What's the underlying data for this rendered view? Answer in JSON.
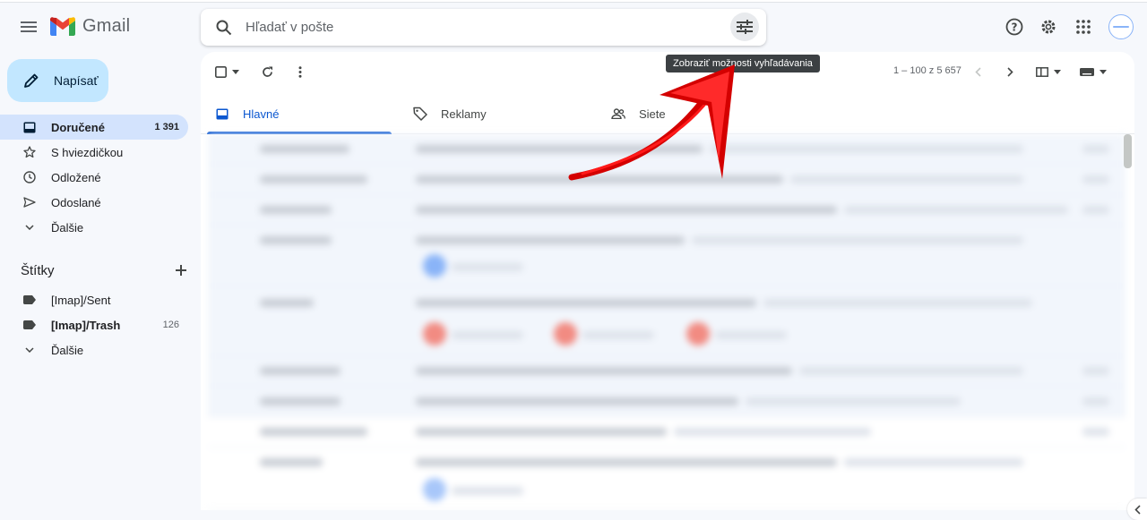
{
  "app": {
    "name": "Gmail"
  },
  "search": {
    "placeholder": "Hľadať v pošte",
    "options_tooltip": "Zobraziť možnosti vyhľadávania"
  },
  "compose": {
    "label": "Napísať"
  },
  "nav": {
    "items": [
      {
        "label": "Doručené",
        "count": "1 391",
        "icon": "inbox-icon",
        "active": true
      },
      {
        "label": "S hviezdičkou",
        "count": "",
        "icon": "star-icon"
      },
      {
        "label": "Odložené",
        "count": "",
        "icon": "clock-icon"
      },
      {
        "label": "Odoslané",
        "count": "",
        "icon": "send-icon"
      },
      {
        "label": "Ďalšie",
        "count": "",
        "icon": "chevron-down-icon"
      }
    ]
  },
  "labels": {
    "title": "Štítky",
    "items": [
      {
        "label": "[Imap]/Sent",
        "count": ""
      },
      {
        "label": "[Imap]/Trash",
        "count": "126"
      },
      {
        "label": "Ďalšie",
        "count": ""
      }
    ]
  },
  "toolbar": {
    "pager": "1 – 100 z 5 657"
  },
  "tabs": [
    {
      "label": "Hlavné",
      "icon": "inbox-icon",
      "active": true
    },
    {
      "label": "Reklamy",
      "icon": "tag-icon"
    },
    {
      "label": "Siete",
      "icon": "people-icon"
    }
  ],
  "colors": {
    "accent": "#0b57d0",
    "compose_bg": "#c2e7ff",
    "active_nav": "#d3e3fd",
    "annotation_arrow": "#e00000"
  }
}
